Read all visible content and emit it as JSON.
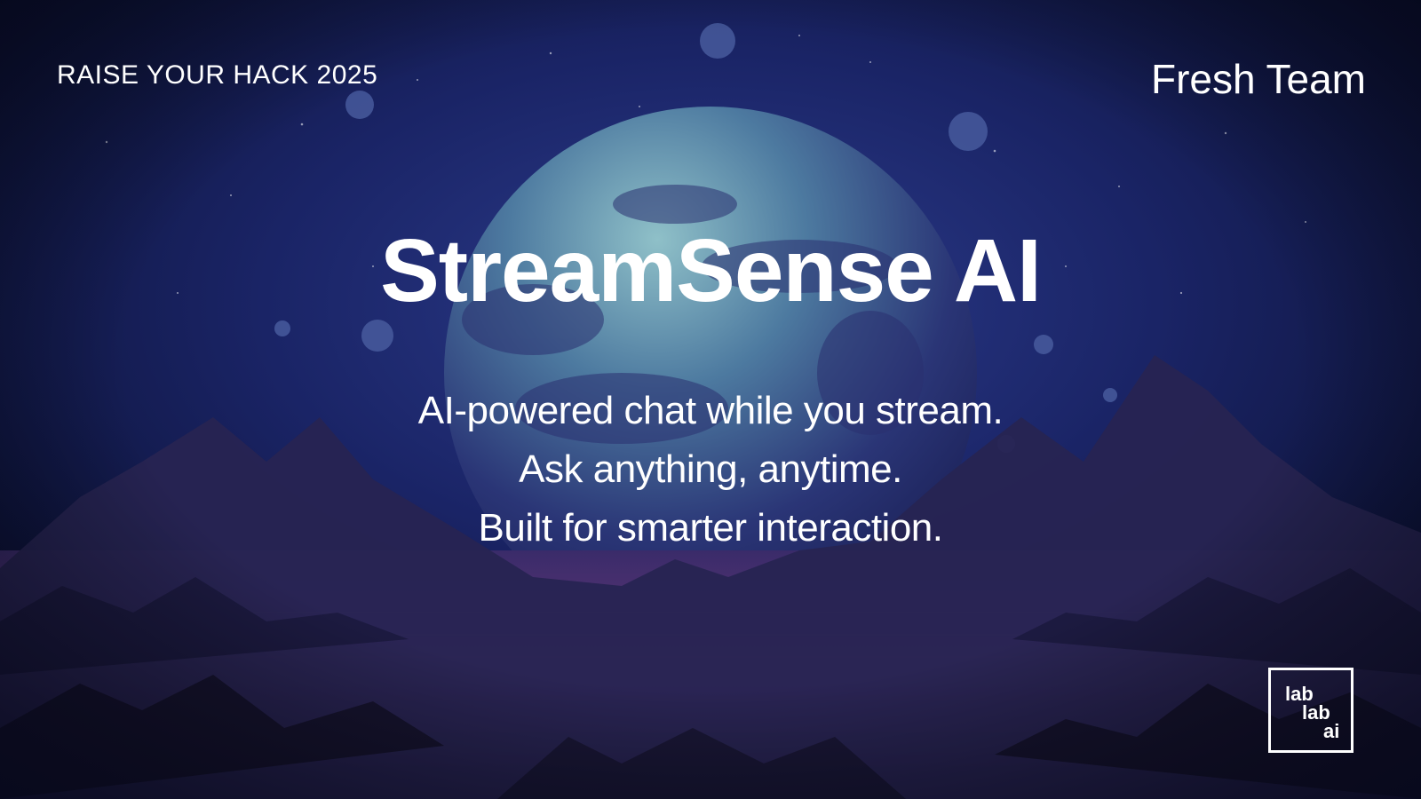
{
  "slide": {
    "event_label": "RAISE YOUR HACK 2025",
    "team_label": "Fresh Team",
    "title": "StreamSense AI",
    "tagline_lines": [
      "AI-powered chat while you stream.",
      "Ask anything, anytime.",
      "Built for smarter interaction."
    ],
    "logo_lines": [
      "lab",
      "lab",
      "ai"
    ]
  },
  "colors": {
    "sky_top": "#0a0f2e",
    "sky_mid": "#1d2a6b",
    "planet": "#5d8fa8",
    "mountains": "#2a2450",
    "ground": "#6b3a78",
    "text": "#ffffff"
  }
}
